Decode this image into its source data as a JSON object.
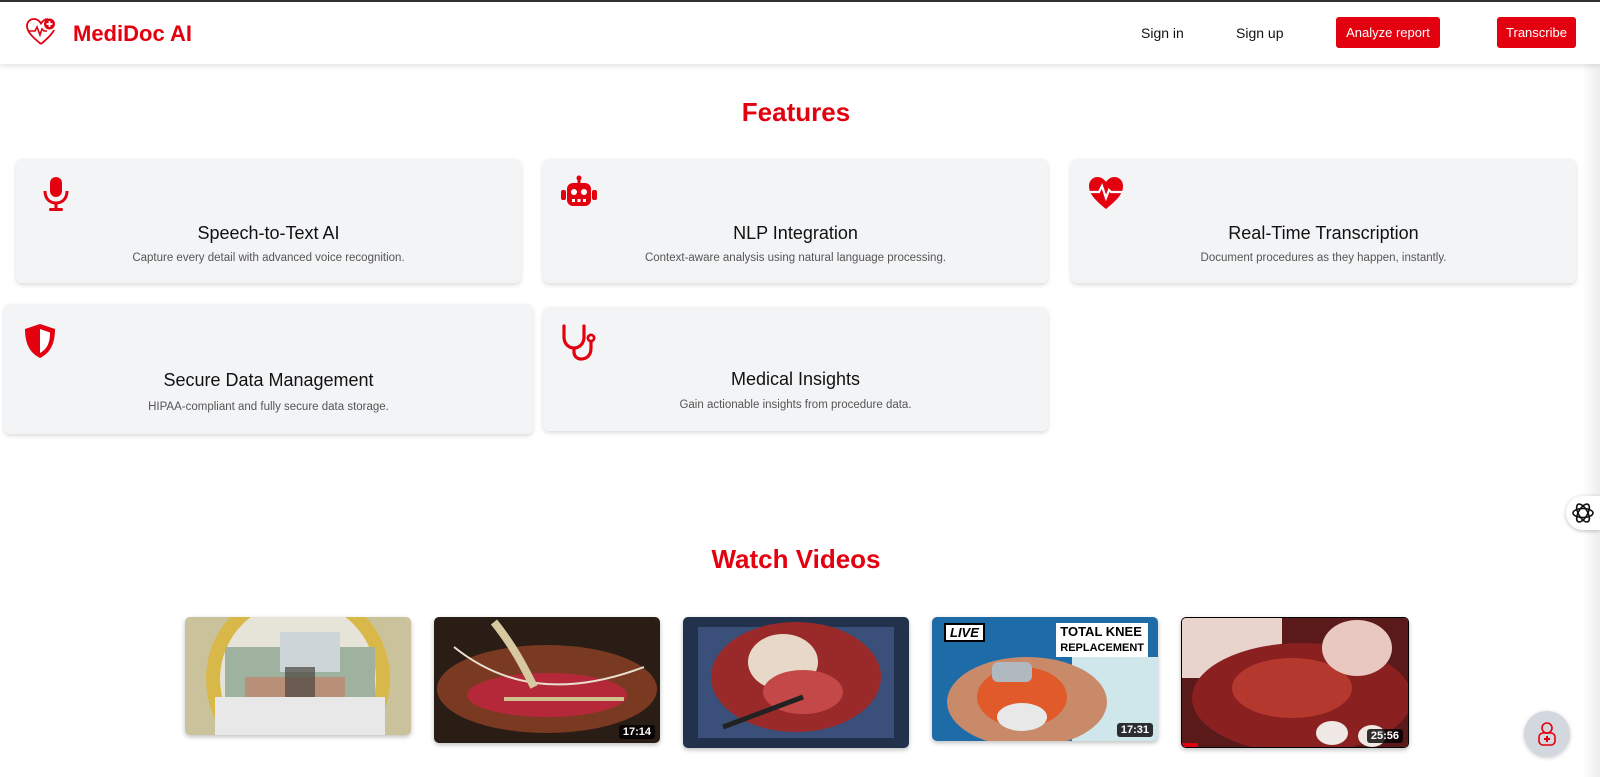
{
  "app": {
    "brand": "MediDoc AI"
  },
  "nav": {
    "sign_in": "Sign in",
    "sign_up": "Sign up",
    "analyze_report": "Analyze report",
    "transcribe": "Transcribe"
  },
  "colors": {
    "accent": "#e3000f",
    "card_bg": "#f3f4f6"
  },
  "features": {
    "title": "Features",
    "items": [
      {
        "icon": "microphone-icon",
        "title": "Speech-to-Text AI",
        "desc": "Capture every detail with advanced voice recognition."
      },
      {
        "icon": "robot-icon",
        "title": "NLP Integration",
        "desc": "Context-aware analysis using natural language processing."
      },
      {
        "icon": "heart-pulse-icon",
        "title": "Real-Time Transcription",
        "desc": "Document procedures as they happen, instantly."
      },
      {
        "icon": "shield-icon",
        "title": "Secure Data Management",
        "desc": "HIPAA-compliant and fully secure data storage."
      },
      {
        "icon": "stethoscope-icon",
        "title": "Medical Insights",
        "desc": "Gain actionable insights from procedure data."
      }
    ]
  },
  "videos": {
    "title": "Watch Videos",
    "items": [
      {
        "duration": ""
      },
      {
        "duration": "17:14"
      },
      {
        "duration": ""
      },
      {
        "duration": "17:31",
        "badge_live": "LIVE",
        "badge_title_1": "TOTAL KNEE",
        "badge_title_2": "REPLACEMENT"
      },
      {
        "duration": "25:56"
      }
    ]
  }
}
